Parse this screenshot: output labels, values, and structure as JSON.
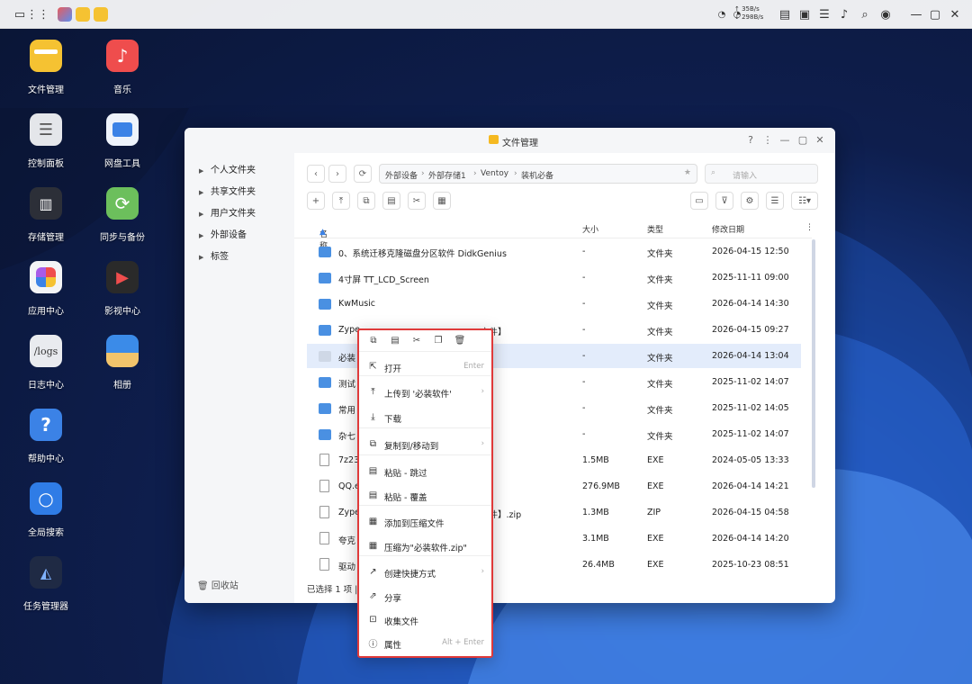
{
  "desktop": {
    "icons": [
      {
        "label": "文件管理"
      },
      {
        "label": "音乐"
      },
      {
        "label": "控制面板"
      },
      {
        "label": "网盘工具"
      },
      {
        "label": "存储管理"
      },
      {
        "label": "同步与备份"
      },
      {
        "label": "应用中心"
      },
      {
        "label": "影视中心"
      },
      {
        "label": "日志中心",
        "icon_text": "/logs"
      },
      {
        "label": "相册"
      },
      {
        "label": "帮助中心",
        "icon_text": "?"
      },
      {
        "label": "全局搜索"
      },
      {
        "label": "任务管理器"
      }
    ]
  },
  "topbar": {
    "net_up": "↑ 35B/s",
    "net_down": "↓ 298B/s",
    "cpu": "CPU",
    "ram": "RAM"
  },
  "window": {
    "title": "文件管理",
    "help": "?",
    "sidebar": [
      {
        "label": "个人文件夹"
      },
      {
        "label": "共享文件夹"
      },
      {
        "label": "用户文件夹"
      },
      {
        "label": "外部设备"
      },
      {
        "label": "标签"
      }
    ],
    "recycle_bin": "回收站",
    "path": [
      "外部设备",
      "外部存储1",
      "Ventoy",
      "装机必备"
    ],
    "search_placeholder": "请输入",
    "columns": {
      "name": "名称",
      "size": "大小",
      "type": "类型",
      "date": "修改日期"
    },
    "rows": [
      {
        "name": "0、系统迁移克隆磁盘分区软件 DidkGenius",
        "size": "-",
        "type": "文件夹",
        "date": "2026-04-15 12:50",
        "kind": "folder"
      },
      {
        "name": "4寸屏  TT_LCD_Screen",
        "size": "-",
        "type": "文件夹",
        "date": "2025-11-11 09:00",
        "kind": "folder"
      },
      {
        "name": "KwMusic",
        "size": "-",
        "type": "文件夹",
        "date": "2026-04-14 14:30",
        "kind": "folder"
      },
      {
        "name": "Zype",
        "name_tail": "文件】",
        "size": "-",
        "type": "文件夹",
        "date": "2026-04-15 09:27",
        "kind": "folder"
      },
      {
        "name": "必装",
        "size": "-",
        "type": "文件夹",
        "date": "2026-04-14 13:04",
        "kind": "folder-empty",
        "selected": true
      },
      {
        "name": "测试",
        "size": "-",
        "type": "文件夹",
        "date": "2025-11-02 14:07",
        "kind": "folder"
      },
      {
        "name": "常用",
        "size": "-",
        "type": "文件夹",
        "date": "2025-11-02 14:05",
        "kind": "folder"
      },
      {
        "name": "杂七",
        "size": "-",
        "type": "文件夹",
        "date": "2025-11-02 14:07",
        "kind": "folder"
      },
      {
        "name": "7z23",
        "size": "1.5MB",
        "type": "EXE",
        "date": "2024-05-05 13:33",
        "kind": "file"
      },
      {
        "name": "QQ.e",
        "size": "276.9MB",
        "type": "EXE",
        "date": "2026-04-14 14:21",
        "kind": "file"
      },
      {
        "name": "Zype",
        "name_tail": "文件】.zip",
        "size": "1.3MB",
        "type": "ZIP",
        "date": "2026-04-15 04:58",
        "kind": "file"
      },
      {
        "name": "夸克",
        "size": "3.1MB",
        "type": "EXE",
        "date": "2026-04-14 14:20",
        "kind": "file"
      },
      {
        "name": "驱动",
        "size": "26.4MB",
        "type": "EXE",
        "date": "2025-10-23 08:51",
        "kind": "file"
      }
    ],
    "status": "已选择 1 项 |"
  },
  "context_menu": {
    "items": [
      {
        "label": "打开",
        "shortcut": "Enter"
      },
      {
        "label": "上传到 '必装软件'",
        "shortcut": "›"
      },
      {
        "label": "下载",
        "shortcut": ""
      },
      {
        "label": "复制到/移动到",
        "shortcut": "›"
      },
      {
        "label": "粘贴 - 跳过",
        "shortcut": ""
      },
      {
        "label": "粘贴 - 覆盖",
        "shortcut": ""
      },
      {
        "label": "添加到压缩文件",
        "shortcut": ""
      },
      {
        "label": "压缩为\"必装软件.zip\"",
        "shortcut": ""
      },
      {
        "label": "创建快捷方式",
        "shortcut": "›"
      },
      {
        "label": "分享",
        "shortcut": ""
      },
      {
        "label": "收集文件",
        "shortcut": ""
      },
      {
        "label": "属性",
        "shortcut": "Alt + Enter"
      }
    ]
  }
}
